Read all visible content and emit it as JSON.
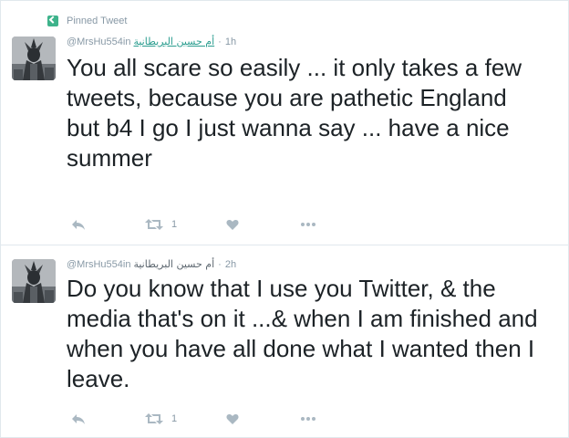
{
  "pinned": {
    "label": "Pinned Tweet",
    "icon": "pin-icon",
    "color": "#3eb38b"
  },
  "tweets": [
    {
      "handle": "@MrsHu554in",
      "display_name": "أم حسين البريطانية",
      "separator": "·",
      "time": "1h",
      "text": "You all scare so easily ... it only takes a few tweets, because you are pathetic England\nbut b4 I go I just wanna say ... have a nice summer",
      "retweet_count": "1"
    },
    {
      "handle": "@MrsHu554in",
      "display_name": "أم حسين البريطانية",
      "separator": "·",
      "time": "2h",
      "text": "Do you know that I use you Twitter, & the media that's on it ...& when I am finished and when you have all done what I wanted then I leave.",
      "retweet_count": "1"
    }
  ],
  "icons": {
    "reply": "reply-icon",
    "retweet": "retweet-icon",
    "like": "heart-icon",
    "more": "more-icon"
  },
  "colors": {
    "action_gray": "#aab8c2",
    "meta_gray": "#8899a6",
    "text": "#1c2226",
    "divider": "#e1e8ed"
  }
}
